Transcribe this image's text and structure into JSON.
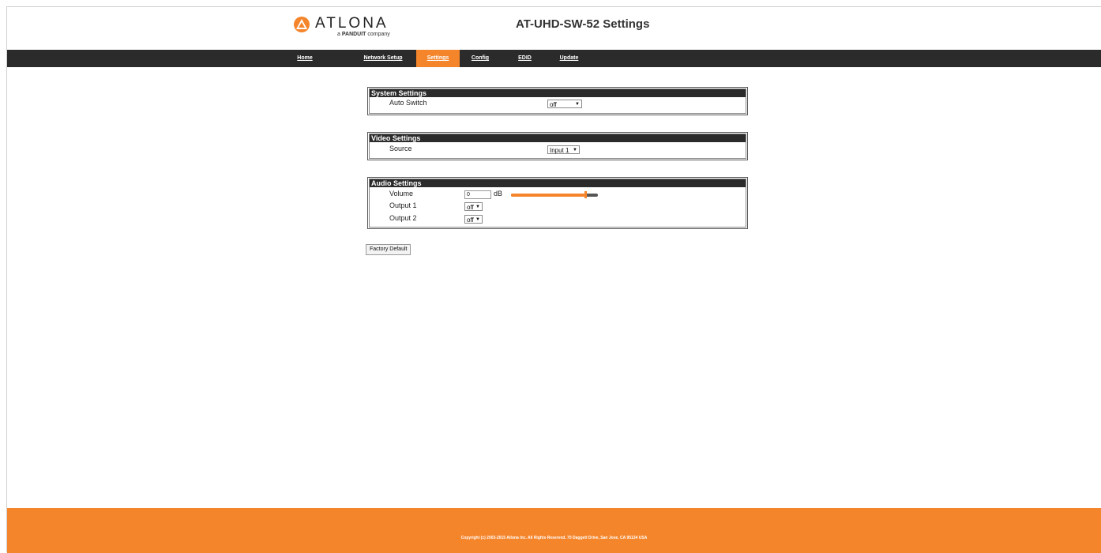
{
  "header": {
    "logo_word": "ATLONA",
    "logo_sub_prefix": "a",
    "logo_sub_brand": "PANDUIT",
    "logo_sub_suffix": "company",
    "title": "AT-UHD-SW-52 Settings"
  },
  "nav": {
    "items": [
      {
        "label": "Home"
      },
      {
        "label": "Network Setup"
      },
      {
        "label": "Settings",
        "active": true
      },
      {
        "label": "Config"
      },
      {
        "label": "EDID"
      },
      {
        "label": "Update"
      }
    ]
  },
  "system_settings": {
    "title": "System Settings",
    "auto_switch_label": "Auto Switch",
    "auto_switch_value": "off"
  },
  "video_settings": {
    "title": "Video Settings",
    "source_label": "Source",
    "source_value": "Input 1"
  },
  "audio_settings": {
    "title": "Audio Settings",
    "volume_label": "Volume",
    "volume_value": "0",
    "volume_unit": "dB",
    "volume_slider_fraction": 0.85,
    "output1_label": "Output 1",
    "output1_value": "off",
    "output2_label": "Output 2",
    "output2_value": "off"
  },
  "actions": {
    "factory_default": "Factory Default"
  },
  "footer": {
    "copyright": "Copyright (c) 2003-2015 Atlona Inc. All Rights Reserved. 70 Daggett Drive, San Jose, CA 95134 USA"
  },
  "colors": {
    "accent": "#f5852b",
    "nav_bg": "#2b2b2b"
  }
}
